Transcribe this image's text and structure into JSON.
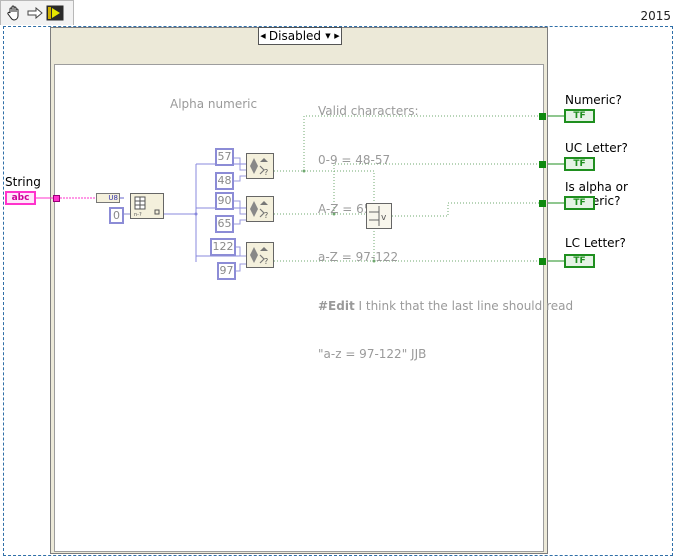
{
  "toolbar": {
    "icons": [
      "hand-icon",
      "arrow-icon",
      "run-icon"
    ]
  },
  "year": "2015",
  "case_selector": {
    "value": "Disabled"
  },
  "comments": {
    "alpha_numeric": "Alpha numeric",
    "valid_line1": "Valid characters:",
    "valid_line2": "0-9 = 48-57",
    "valid_line3": "A-Z = 65-90",
    "valid_line4": "a-Z = 97-122",
    "edit_bold": "#Edit",
    "edit_text": " I think that the last line should read",
    "edit_line2": "\"a-z = 97-122\" JJB"
  },
  "controls": {
    "string_label": "String",
    "string_terminal": "abc"
  },
  "constants": [
    "57",
    "48",
    "90",
    "65",
    "122",
    "97",
    "0"
  ],
  "conversion": {
    "u8_label": "U8"
  },
  "indicators": [
    {
      "label": "Numeric?",
      "terminal": "TF"
    },
    {
      "label": "UC Letter?",
      "terminal": "TF"
    },
    {
      "label": "Is alpha or numeric?",
      "terminal": "TF"
    },
    {
      "label": "LC Letter?",
      "terminal": "TF"
    }
  ],
  "colors": {
    "wire_bool": "#1f8f1f",
    "wire_numeric": "#6666cc",
    "wire_string": "#ff33cc",
    "border": "#2f6fa8"
  }
}
